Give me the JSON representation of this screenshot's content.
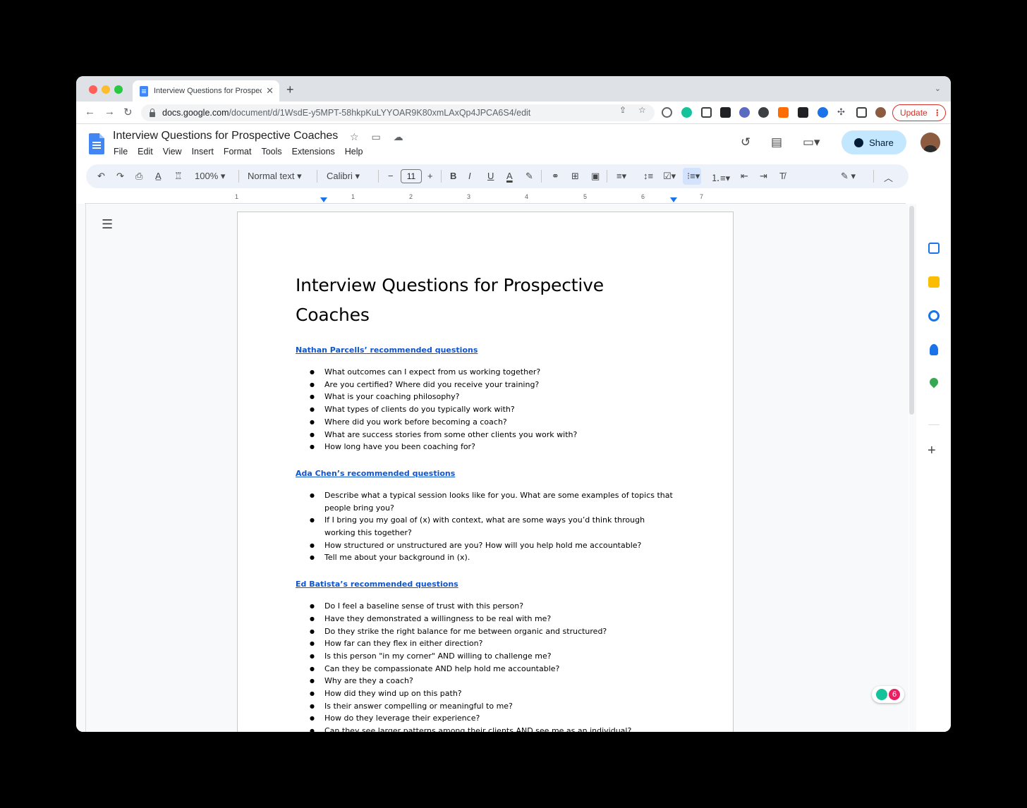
{
  "browser": {
    "tab_title": "Interview Questions for Prospective Coaches - Google Docs",
    "new_tab": "+",
    "url_host": "docs.google.com",
    "url_path": "/document/d/1WsdE-y5MPT-58hkpKuLYYOAR9K80xmLAxQp4JPCA6S4/edit",
    "update_label": "Update"
  },
  "docs": {
    "title": "Interview Questions for Prospective Coaches",
    "menus": [
      "File",
      "Edit",
      "View",
      "Insert",
      "Format",
      "Tools",
      "Extensions",
      "Help"
    ],
    "share_label": "Share"
  },
  "toolbar": {
    "zoom": "100%",
    "style": "Normal text",
    "font": "Calibri",
    "font_size": "11"
  },
  "ruler": [
    "1",
    "1",
    "2",
    "3",
    "4",
    "5",
    "6",
    "7"
  ],
  "document": {
    "heading": "Interview Questions for Prospective Coaches",
    "sections": [
      {
        "title": "Nathan Parcells’ recommended questions",
        "items": [
          "What outcomes can I expect from us working together?",
          "Are you certified? Where did you receive your training?",
          "What is your coaching philosophy?",
          "What types of clients do you typically work with?",
          "Where did you work before becoming a coach?",
          "What are success stories from some other clients you work with?",
          "How long have you been coaching for?"
        ]
      },
      {
        "title": "Ada Chen’s recommended questions",
        "items": [
          "Describe what a typical session looks like for you. What are some examples of topics that people bring you?",
          "If I bring you my goal of (x) with context, what are some ways you’d think through working this together?",
          "How structured or unstructured are you? How will you help hold me accountable?",
          "Tell me about your background in (x)."
        ]
      },
      {
        "title": "Ed Batista’s recommended questions",
        "items": [
          "Do I feel a baseline sense of trust with this person?",
          "Have they demonstrated a willingness to be real with me?",
          "Do they strike the right balance for me between organic and structured?",
          "How far can they flex in either direction?",
          "Is this person \"in my corner\" AND willing to challenge me?",
          "Can they be compassionate AND help hold me accountable?",
          "Why are they a coach?",
          "How did they wind up on this path?",
          "Is their answer compelling or meaningful to me?",
          "How do they leverage their experience?",
          "Can they see larger patterns among their clients AND see me as an individual?"
        ]
      }
    ]
  },
  "grammarly_count": "6",
  "colors": {
    "link": "#1155cc",
    "share_bg": "#c2e7ff",
    "toolbar_bg": "#edf2fa",
    "update_red": "#d93025"
  }
}
